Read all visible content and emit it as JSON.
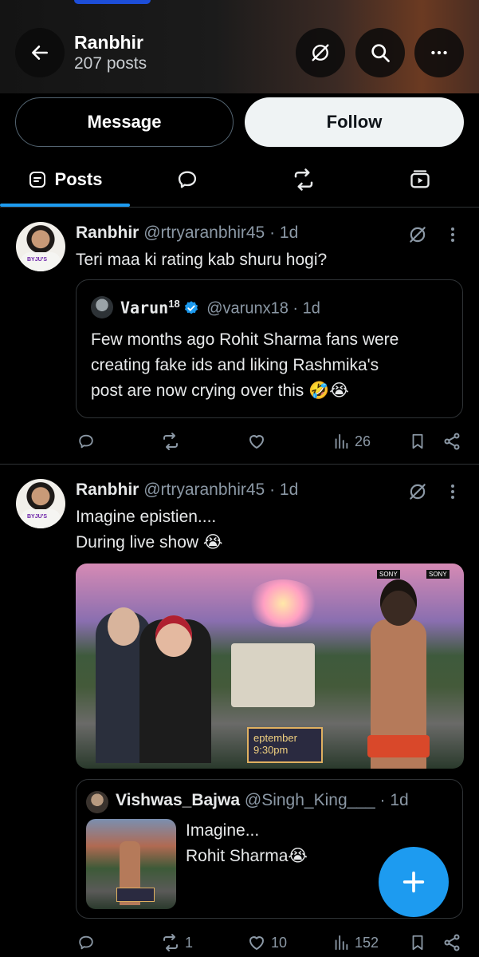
{
  "header": {
    "title": "Ranbhir",
    "subtitle": "207 posts"
  },
  "profile_actions": {
    "message_label": "Message",
    "follow_label": "Follow"
  },
  "tabs": {
    "posts_label": "Posts"
  },
  "posts": [
    {
      "name": "Ranbhir",
      "handle": "@rtryaranbhir45 · 1d",
      "text": "Teri maa ki rating kab shuru hogi?",
      "quote": {
        "name": "Varun",
        "name_sup": "18",
        "handle": "@varunx18 · 1d",
        "lines": [
          "Few months ago Rohit Sharma fans were",
          "creating fake ids and liking Rashmika's",
          "post are now crying over this 🤣😭"
        ]
      },
      "actions": {
        "views": "26"
      }
    },
    {
      "name": "Ranbhir",
      "handle": "@rtryaranbhir45 · 1d",
      "lines": [
        "Imagine epistien....",
        "During live show 😭"
      ],
      "media_overlay": {
        "channel1": "SONY",
        "channel2": "SONY",
        "screen_line1": "eptember",
        "screen_line2": "9:30pm"
      },
      "quote": {
        "name": "Vishwas_Bajwa",
        "handle": "@Singh_King___ · 1d",
        "lines": [
          "Imagine...",
          "Rohit Sharma😭"
        ]
      },
      "actions": {
        "reposts": "1",
        "likes": "10",
        "views": "152"
      }
    }
  ],
  "colors": {
    "accent": "#1d9bf0",
    "background": "#000000",
    "muted_text": "#8b98a5",
    "border": "#2f3336"
  }
}
